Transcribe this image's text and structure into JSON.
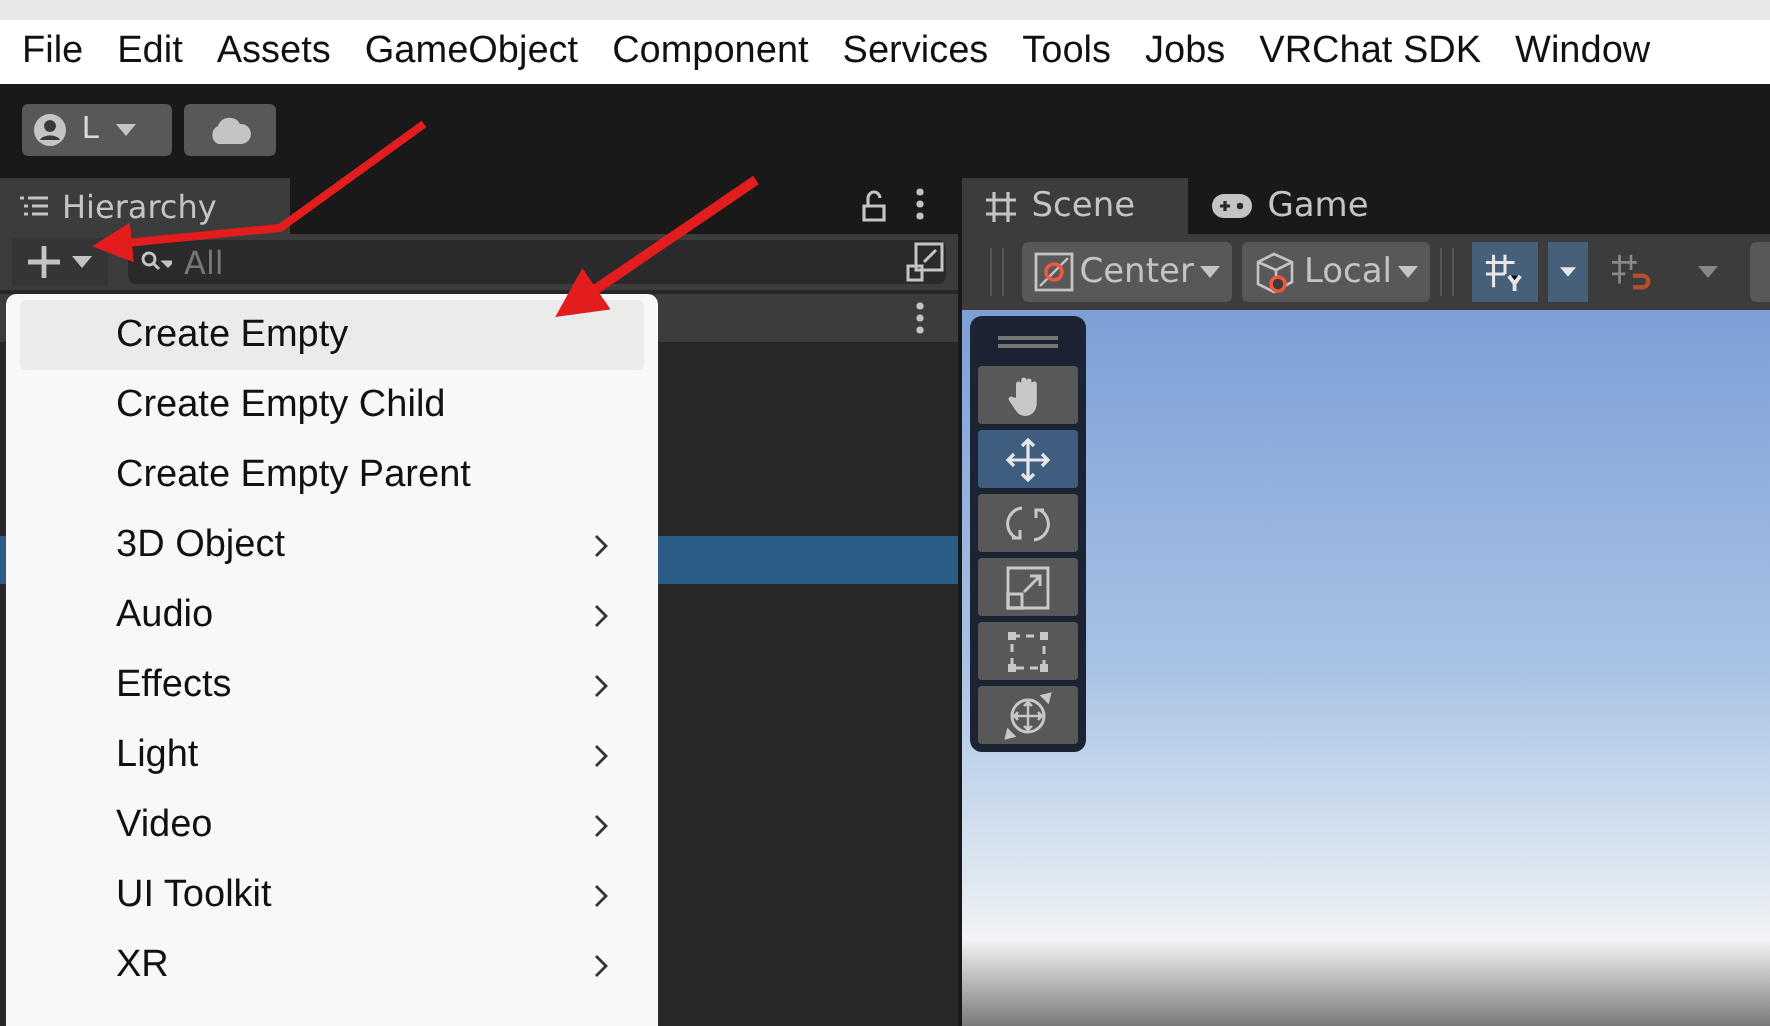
{
  "menu_bar": [
    "File",
    "Edit",
    "Assets",
    "GameObject",
    "Component",
    "Services",
    "Tools",
    "Jobs",
    "VRChat SDK",
    "Window"
  ],
  "toolbar": {
    "account_label": "L"
  },
  "hierarchy": {
    "tab": "Hierarchy",
    "search": {
      "placeholder": "All"
    }
  },
  "scene": {
    "tabs": [
      {
        "label": "Scene",
        "selected": true,
        "kind": "scene"
      },
      {
        "label": "Game",
        "selected": false,
        "kind": "game"
      }
    ],
    "pivot_buttons": [
      {
        "label": "Center",
        "kind": "center"
      },
      {
        "label": "Local",
        "kind": "local"
      }
    ],
    "tools": [
      {
        "kind": "hand",
        "selected": false
      },
      {
        "kind": "move",
        "selected": true
      },
      {
        "kind": "rotate",
        "selected": false
      },
      {
        "kind": "scale",
        "selected": false
      },
      {
        "kind": "rect",
        "selected": false
      },
      {
        "kind": "transform",
        "selected": false
      }
    ]
  },
  "create_menu": [
    {
      "label": "Create Empty",
      "selected": true,
      "submenu": false
    },
    {
      "label": "Create Empty Child",
      "selected": false,
      "submenu": false
    },
    {
      "label": "Create Empty Parent",
      "selected": false,
      "submenu": false
    },
    {
      "label": "3D Object",
      "selected": false,
      "submenu": true
    },
    {
      "label": "Audio",
      "selected": false,
      "submenu": true
    },
    {
      "label": "Effects",
      "selected": false,
      "submenu": true
    },
    {
      "label": "Light",
      "selected": false,
      "submenu": true
    },
    {
      "label": "Video",
      "selected": false,
      "submenu": true
    },
    {
      "label": "UI Toolkit",
      "selected": false,
      "submenu": true
    },
    {
      "label": "XR",
      "selected": false,
      "submenu": true
    }
  ]
}
